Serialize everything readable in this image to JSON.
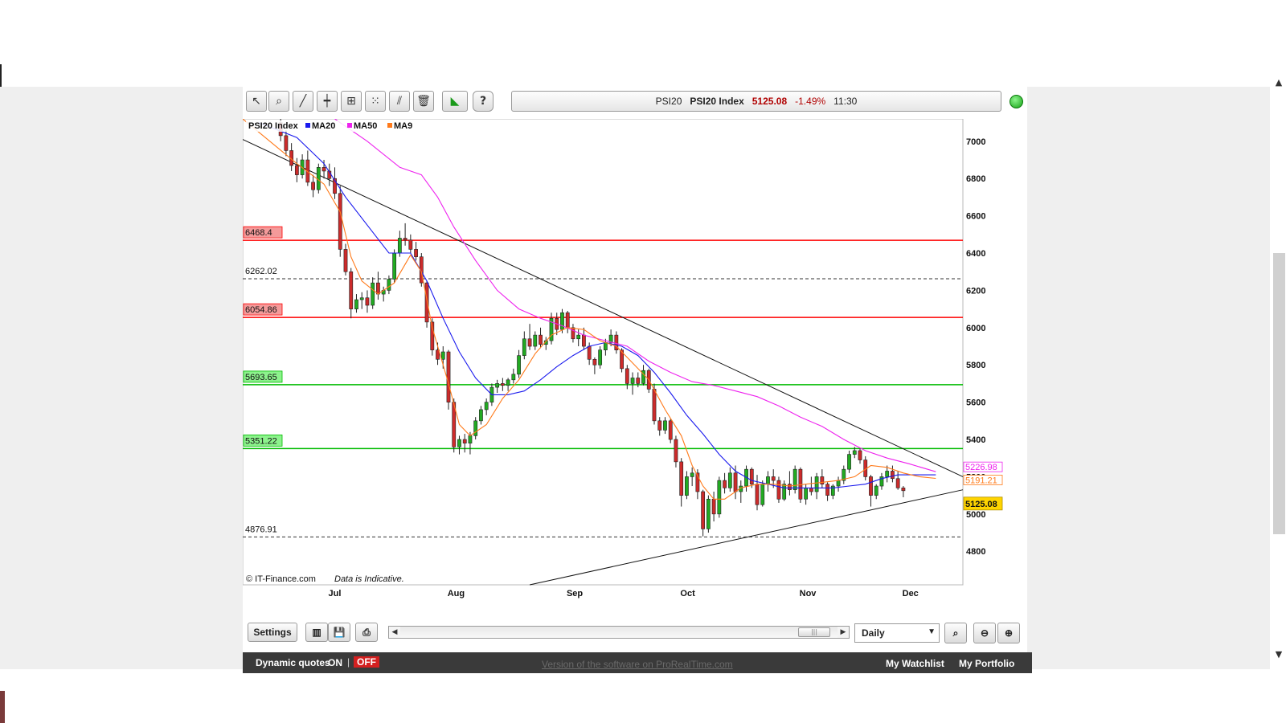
{
  "toolbar": {
    "tools": [
      {
        "name": "pointer-tool-button",
        "icon": "pointer-icon",
        "glyph": "↖"
      },
      {
        "name": "zoom-tool-button",
        "icon": "magnifier-icon",
        "glyph": "⌕"
      },
      {
        "name": "trendline-tool-button",
        "icon": "trendline-icon",
        "glyph": "╱"
      },
      {
        "name": "horizontal-line-tool-button",
        "icon": "crosshair-line-icon",
        "glyph": "┿"
      },
      {
        "name": "indicator-tool-button",
        "icon": "indicator-icon",
        "glyph": "⊞"
      },
      {
        "name": "points-tool-button",
        "icon": "points-icon",
        "glyph": "⁙"
      },
      {
        "name": "channel-tool-button",
        "icon": "channel-icon",
        "glyph": "⫽"
      },
      {
        "name": "delete-tool-button",
        "icon": "trash-icon",
        "glyph": "🗑"
      },
      {
        "name": "prorealtime-button",
        "icon": "prorealtime-logo-icon",
        "glyph": "◣"
      },
      {
        "name": "help-button",
        "icon": "help-icon",
        "glyph": "?"
      }
    ]
  },
  "quote": {
    "symbol": "PSI20",
    "name": "PSI20 Index",
    "price": "5125.08",
    "change": "-1.49%",
    "time": "11:30"
  },
  "colors": {
    "candle_up": "#22aa22",
    "candle_down": "#cc2b2b",
    "ma20": "#1a1aee",
    "ma50": "#ee22ee",
    "ma9": "#ff7a1a",
    "resistance": "#ff0000",
    "support": "#00bb00",
    "status": "#1ab01a"
  },
  "chart_data": {
    "type": "candlestick",
    "title": "PSI20 Index",
    "legend": [
      {
        "name": "MA20",
        "color": "#1a1aee"
      },
      {
        "name": "MA50",
        "color": "#ee22ee"
      },
      {
        "name": "MA9",
        "color": "#ff7a1a"
      }
    ],
    "legend_placement": "top-left",
    "x_ticks": [
      {
        "i": 10,
        "label": "Jul"
      },
      {
        "i": 32,
        "label": "Aug"
      },
      {
        "i": 54,
        "label": "Sep"
      },
      {
        "i": 75,
        "label": "Oct"
      },
      {
        "i": 97,
        "label": "Nov"
      },
      {
        "i": 116,
        "label": "Dec"
      }
    ],
    "y_ticks": [
      4800,
      5000,
      5200,
      5400,
      5600,
      5800,
      6000,
      6200,
      6400,
      6600,
      6800,
      7000
    ],
    "ylim": [
      4620,
      7120
    ],
    "x_range": [
      -7,
      126
    ],
    "levels": [
      {
        "value": 6468.4,
        "label": "6468.4",
        "style": "resistance"
      },
      {
        "value": 6262.02,
        "label": "6262.02",
        "style": "dashed"
      },
      {
        "value": 6054.86,
        "label": "6054.86",
        "style": "resistance"
      },
      {
        "value": 5693.65,
        "label": "5693.65",
        "style": "support"
      },
      {
        "value": 5351.22,
        "label": "5351.22",
        "style": "support"
      },
      {
        "value": 4876.91,
        "label": "4876.91",
        "style": "dashed"
      }
    ],
    "trendlines": [
      {
        "i0": -7,
        "v0": 7010,
        "i1": 126,
        "v1": 5200
      },
      {
        "i0": 46,
        "v0": 4620,
        "i1": 126,
        "v1": 5130
      }
    ],
    "last_values": [
      {
        "label": "5226.98",
        "value": 5226.98,
        "color": "#ee22ee"
      },
      {
        "label": "5191.21",
        "value": 5191.21,
        "color": "#ff7a1a"
      },
      {
        "label": "5125.08",
        "value": 5125.08,
        "color": "#ffd400"
      }
    ],
    "candles": [
      [
        7100,
        7140,
        7000,
        7030
      ],
      [
        7030,
        7060,
        6920,
        6950
      ],
      [
        6950,
        6990,
        6840,
        6870
      ],
      [
        6870,
        6910,
        6780,
        6820
      ],
      [
        6820,
        6930,
        6800,
        6900
      ],
      [
        6900,
        6950,
        6760,
        6780
      ],
      [
        6780,
        6820,
        6700,
        6740
      ],
      [
        6740,
        6880,
        6720,
        6860
      ],
      [
        6860,
        6900,
        6800,
        6840
      ],
      [
        6840,
        6880,
        6760,
        6800
      ],
      [
        6800,
        6860,
        6690,
        6720
      ],
      [
        6720,
        6760,
        6380,
        6420
      ],
      [
        6420,
        6450,
        6280,
        6300
      ],
      [
        6300,
        6320,
        6050,
        6100
      ],
      [
        6100,
        6180,
        6080,
        6150
      ],
      [
        6150,
        6190,
        6100,
        6160
      ],
      [
        6160,
        6200,
        6080,
        6120
      ],
      [
        6120,
        6270,
        6100,
        6240
      ],
      [
        6240,
        6300,
        6150,
        6180
      ],
      [
        6180,
        6220,
        6140,
        6200
      ],
      [
        6200,
        6280,
        6180,
        6260
      ],
      [
        6260,
        6420,
        6240,
        6400
      ],
      [
        6400,
        6520,
        6380,
        6480
      ],
      [
        6480,
        6560,
        6440,
        6470
      ],
      [
        6470,
        6500,
        6400,
        6420
      ],
      [
        6420,
        6460,
        6360,
        6380
      ],
      [
        6380,
        6400,
        6220,
        6240
      ],
      [
        6240,
        6250,
        6000,
        6030
      ],
      [
        6030,
        6050,
        5850,
        5880
      ],
      [
        5880,
        5920,
        5800,
        5830
      ],
      [
        5830,
        5900,
        5780,
        5870
      ],
      [
        5870,
        5880,
        5560,
        5600
      ],
      [
        5600,
        5620,
        5330,
        5360
      ],
      [
        5360,
        5420,
        5320,
        5400
      ],
      [
        5400,
        5430,
        5330,
        5380
      ],
      [
        5380,
        5440,
        5320,
        5420
      ],
      [
        5420,
        5520,
        5400,
        5500
      ],
      [
        5500,
        5580,
        5480,
        5560
      ],
      [
        5560,
        5620,
        5530,
        5600
      ],
      [
        5600,
        5700,
        5580,
        5680
      ],
      [
        5680,
        5720,
        5650,
        5700
      ],
      [
        5700,
        5730,
        5660,
        5690
      ],
      [
        5690,
        5730,
        5660,
        5720
      ],
      [
        5720,
        5780,
        5700,
        5750
      ],
      [
        5750,
        5880,
        5730,
        5850
      ],
      [
        5850,
        5980,
        5830,
        5940
      ],
      [
        5940,
        6020,
        5880,
        5900
      ],
      [
        5900,
        5980,
        5880,
        5960
      ],
      [
        5960,
        6000,
        5890,
        5910
      ],
      [
        5910,
        5950,
        5880,
        5930
      ],
      [
        5930,
        6080,
        5910,
        6050
      ],
      [
        6050,
        6080,
        5960,
        5990
      ],
      [
        5990,
        6100,
        5970,
        6080
      ],
      [
        6080,
        6090,
        5970,
        6000
      ],
      [
        6000,
        6020,
        5920,
        5940
      ],
      [
        5940,
        5990,
        5900,
        5960
      ],
      [
        5960,
        6000,
        5880,
        5900
      ],
      [
        5900,
        5920,
        5800,
        5830
      ],
      [
        5830,
        5840,
        5750,
        5800
      ],
      [
        5800,
        5900,
        5780,
        5880
      ],
      [
        5880,
        5940,
        5850,
        5920
      ],
      [
        5920,
        5990,
        5900,
        5960
      ],
      [
        5960,
        5980,
        5860,
        5880
      ],
      [
        5880,
        5890,
        5760,
        5780
      ],
      [
        5780,
        5800,
        5670,
        5700
      ],
      [
        5700,
        5760,
        5640,
        5730
      ],
      [
        5730,
        5760,
        5680,
        5700
      ],
      [
        5700,
        5800,
        5690,
        5770
      ],
      [
        5770,
        5780,
        5650,
        5670
      ],
      [
        5670,
        5700,
        5480,
        5500
      ],
      [
        5500,
        5520,
        5420,
        5450
      ],
      [
        5450,
        5520,
        5430,
        5500
      ],
      [
        5500,
        5510,
        5380,
        5400
      ],
      [
        5400,
        5420,
        5250,
        5280
      ],
      [
        5280,
        5300,
        5040,
        5100
      ],
      [
        5100,
        5230,
        5080,
        5200
      ],
      [
        5200,
        5250,
        5150,
        5220
      ],
      [
        5220,
        5240,
        5080,
        5120
      ],
      [
        5120,
        5130,
        4880,
        4920
      ],
      [
        4920,
        5100,
        4900,
        5080
      ],
      [
        5080,
        5120,
        4960,
        5000
      ],
      [
        5000,
        5200,
        4980,
        5180
      ],
      [
        5180,
        5220,
        5110,
        5140
      ],
      [
        5140,
        5250,
        5120,
        5220
      ],
      [
        5220,
        5260,
        5080,
        5120
      ],
      [
        5120,
        5180,
        5060,
        5150
      ],
      [
        5150,
        5260,
        5120,
        5240
      ],
      [
        5240,
        5250,
        5140,
        5160
      ],
      [
        5160,
        5210,
        5020,
        5050
      ],
      [
        5050,
        5180,
        5040,
        5160
      ],
      [
        5160,
        5230,
        5120,
        5200
      ],
      [
        5200,
        5240,
        5140,
        5180
      ],
      [
        5180,
        5200,
        5060,
        5080
      ],
      [
        5080,
        5180,
        5070,
        5160
      ],
      [
        5160,
        5230,
        5100,
        5130
      ],
      [
        5130,
        5260,
        5110,
        5240
      ],
      [
        5240,
        5250,
        5060,
        5080
      ],
      [
        5080,
        5160,
        5050,
        5140
      ],
      [
        5140,
        5200,
        5100,
        5120
      ],
      [
        5120,
        5220,
        5080,
        5200
      ],
      [
        5200,
        5240,
        5140,
        5160
      ],
      [
        5160,
        5170,
        5070,
        5100
      ],
      [
        5100,
        5160,
        5080,
        5150
      ],
      [
        5150,
        5200,
        5120,
        5180
      ],
      [
        5180,
        5260,
        5160,
        5240
      ],
      [
        5240,
        5340,
        5220,
        5320
      ],
      [
        5320,
        5360,
        5300,
        5340
      ],
      [
        5340,
        5350,
        5270,
        5290
      ],
      [
        5290,
        5310,
        5180,
        5200
      ],
      [
        5200,
        5210,
        5040,
        5100
      ],
      [
        5100,
        5160,
        5080,
        5150
      ],
      [
        5150,
        5220,
        5130,
        5200
      ],
      [
        5200,
        5260,
        5170,
        5230
      ],
      [
        5230,
        5260,
        5170,
        5190
      ],
      [
        5190,
        5230,
        5130,
        5140
      ],
      [
        5140,
        5150,
        5090,
        5125.08
      ]
    ],
    "ma9": [
      [
        -7,
        7120
      ],
      [
        3,
        6880
      ],
      [
        8,
        6770
      ],
      [
        11,
        6620
      ],
      [
        13,
        6380
      ],
      [
        15,
        6250
      ],
      [
        18,
        6180
      ],
      [
        21,
        6240
      ],
      [
        24,
        6390
      ],
      [
        26,
        6300
      ],
      [
        28,
        6000
      ],
      [
        31,
        5700
      ],
      [
        33,
        5480
      ],
      [
        35,
        5420
      ],
      [
        38,
        5480
      ],
      [
        41,
        5620
      ],
      [
        44,
        5720
      ],
      [
        47,
        5860
      ],
      [
        50,
        5960
      ],
      [
        53,
        6000
      ],
      [
        56,
        5990
      ],
      [
        59,
        5930
      ],
      [
        62,
        5900
      ],
      [
        65,
        5810
      ],
      [
        68,
        5720
      ],
      [
        71,
        5560
      ],
      [
        74,
        5420
      ],
      [
        76,
        5260
      ],
      [
        78,
        5150
      ],
      [
        80,
        5080
      ],
      [
        82,
        5080
      ],
      [
        85,
        5140
      ],
      [
        88,
        5160
      ],
      [
        91,
        5160
      ],
      [
        94,
        5150
      ],
      [
        97,
        5160
      ],
      [
        100,
        5170
      ],
      [
        103,
        5180
      ],
      [
        106,
        5200
      ],
      [
        109,
        5260
      ],
      [
        112,
        5250
      ],
      [
        115,
        5220
      ],
      [
        118,
        5200
      ],
      [
        121,
        5191.21
      ]
    ],
    "ma20": [
      [
        -4,
        7100
      ],
      [
        3,
        7020
      ],
      [
        8,
        6880
      ],
      [
        12,
        6700
      ],
      [
        16,
        6550
      ],
      [
        20,
        6400
      ],
      [
        24,
        6400
      ],
      [
        27,
        6250
      ],
      [
        30,
        6050
      ],
      [
        33,
        5870
      ],
      [
        36,
        5730
      ],
      [
        39,
        5640
      ],
      [
        42,
        5640
      ],
      [
        45,
        5660
      ],
      [
        48,
        5720
      ],
      [
        51,
        5790
      ],
      [
        54,
        5850
      ],
      [
        57,
        5900
      ],
      [
        60,
        5920
      ],
      [
        63,
        5900
      ],
      [
        66,
        5850
      ],
      [
        69,
        5760
      ],
      [
        72,
        5650
      ],
      [
        75,
        5530
      ],
      [
        78,
        5430
      ],
      [
        81,
        5320
      ],
      [
        84,
        5230
      ],
      [
        87,
        5180
      ],
      [
        90,
        5160
      ],
      [
        93,
        5140
      ],
      [
        96,
        5140
      ],
      [
        99,
        5140
      ],
      [
        102,
        5140
      ],
      [
        105,
        5150
      ],
      [
        108,
        5160
      ],
      [
        111,
        5190
      ],
      [
        114,
        5210
      ],
      [
        117,
        5210
      ],
      [
        121,
        5210
      ]
    ],
    "ma50": [
      [
        10,
        7120
      ],
      [
        16,
        7000
      ],
      [
        22,
        6860
      ],
      [
        26,
        6820
      ],
      [
        29,
        6700
      ],
      [
        32,
        6540
      ],
      [
        36,
        6360
      ],
      [
        40,
        6200
      ],
      [
        44,
        6100
      ],
      [
        48,
        6050
      ],
      [
        52,
        6010
      ],
      [
        56,
        5960
      ],
      [
        60,
        5930
      ],
      [
        64,
        5900
      ],
      [
        68,
        5820
      ],
      [
        72,
        5760
      ],
      [
        76,
        5710
      ],
      [
        80,
        5690
      ],
      [
        84,
        5660
      ],
      [
        88,
        5630
      ],
      [
        92,
        5580
      ],
      [
        96,
        5520
      ],
      [
        100,
        5470
      ],
      [
        104,
        5400
      ],
      [
        108,
        5340
      ],
      [
        112,
        5300
      ],
      [
        116,
        5270
      ],
      [
        121,
        5226.98
      ]
    ],
    "watermark": "© IT-Finance.com",
    "note": "Data is Indicative."
  },
  "navbar": {
    "settings_label": "Settings",
    "period_value": "Daily",
    "buttons": [
      {
        "name": "chart-type-button",
        "icon": "candles-icon",
        "glyph": "▥"
      },
      {
        "name": "save-button",
        "icon": "floppy-icon",
        "glyph": "💾"
      },
      {
        "name": "print-button",
        "icon": "printer-icon",
        "glyph": "⎙"
      }
    ]
  },
  "footer": {
    "dynamic_quotes_label": "Dynamic quotes",
    "on_label": "ON",
    "off_label": "OFF",
    "software_link": "Version of the software on ProRealTime.com",
    "watchlist_label": "My Watchlist",
    "portfolio_label": "My Portfolio"
  }
}
